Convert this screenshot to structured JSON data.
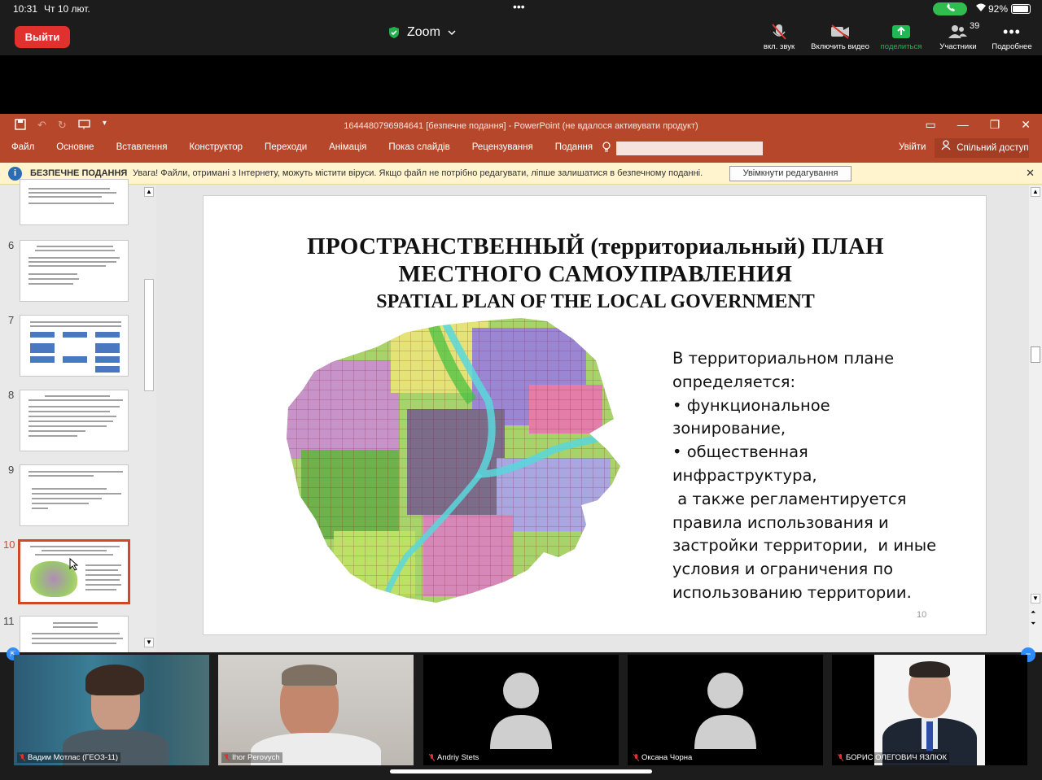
{
  "status": {
    "time": "10:31",
    "date": "Чт 10 лют.",
    "battery": "92%"
  },
  "zoom": {
    "leave": "Выйти",
    "title": "Zoom",
    "buttons": [
      {
        "label": "вкл. звук"
      },
      {
        "label": "Включить видео"
      },
      {
        "label": "поделиться"
      },
      {
        "label": "Участники",
        "count": "39"
      },
      {
        "label": "Подробнее"
      }
    ]
  },
  "ppt": {
    "title": "1644480796984641 [безпечне подання] - PowerPoint (не вдалося активувати продукт)",
    "menu": [
      "Файл",
      "Основне",
      "Вставлення",
      "Конструктор",
      "Переходи",
      "Анімація",
      "Показ слайдів",
      "Рецензування",
      "Подання"
    ],
    "signin": "Увійти",
    "share": "Спільний доступ",
    "protected": {
      "label": "БЕЗПЕЧНЕ ПОДАННЯ",
      "message": "Увага! Файли, отримані з Інтернету, можуть містити віруси. Якщо файл не потрібно редагувати, ліпше залишатися в безпечному поданні.",
      "button": "Увімкнути редагування"
    },
    "thumb_numbers": [
      "6",
      "7",
      "8",
      "9",
      "10",
      "11"
    ],
    "slide": {
      "title1": "ПРОСТРАНСТВЕННЫЙ (территориальный) ПЛАН",
      "title2": "МЕСТНОГО САМОУПРАВЛЕНИЯ",
      "title3": "SPATIAL PLAN OF THE LOCAL GOVERNMENT",
      "body": [
        "В территориальном плане",
        "определяется:",
        "• функциональное",
        "зонирование,",
        "• общественная",
        "инфраструктура,",
        " а также регламентируется",
        "правила использования и",
        "застройки территории,  и иные",
        "условия и ограничения по",
        "использованию территории."
      ],
      "number": "10"
    }
  },
  "participants": [
    {
      "name": "Вадим Мотлас (ГЕОЗ-11)"
    },
    {
      "name": "Ihor Perovych"
    },
    {
      "name": "Andriy Stets"
    },
    {
      "name": "Оксана Чорна"
    },
    {
      "name": "БОРИС ОЛЕГОВИЧ ЯЗЛЮК"
    }
  ],
  "colors": {
    "ribbon": "#b7472a",
    "leave": "#e0312f",
    "share_green": "#1db954",
    "protected_bg": "#fff4ce"
  }
}
